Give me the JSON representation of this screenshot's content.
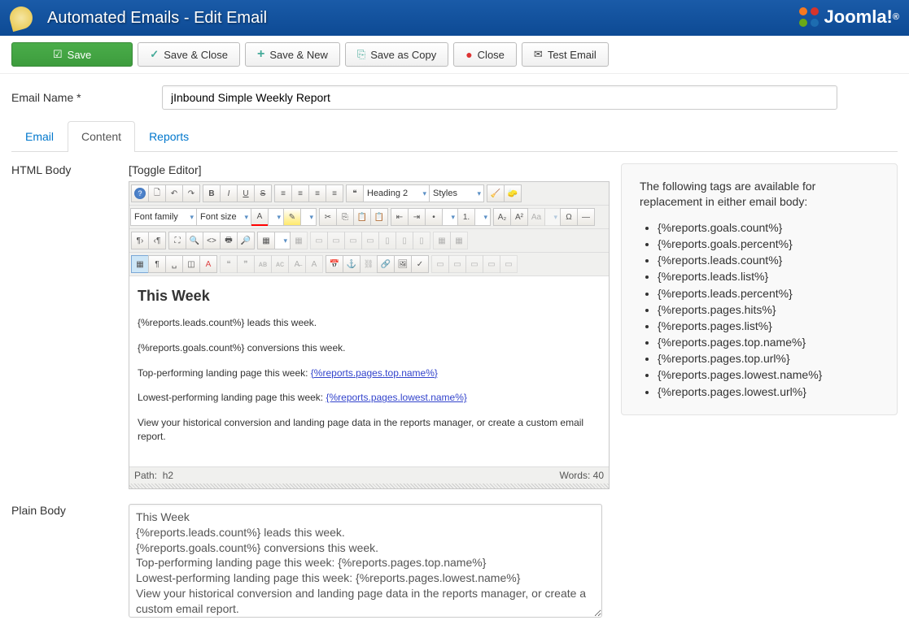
{
  "header": {
    "title": "Automated Emails - Edit Email",
    "logo_text": "Joomla!"
  },
  "toolbar": {
    "save": "Save",
    "save_close": "Save & Close",
    "save_new": "Save & New",
    "save_copy": "Save as Copy",
    "close": "Close",
    "test_email": "Test Email"
  },
  "form": {
    "email_name_label": "Email Name *",
    "email_name_value": "jInbound Simple Weekly Report"
  },
  "tabs": {
    "email": "Email",
    "content": "Content",
    "reports": "Reports",
    "active": "content"
  },
  "editor_area": {
    "html_body_label": "HTML Body",
    "plain_body_label": "Plain Body",
    "toggle_editor": "[Toggle Editor]"
  },
  "editor_toolbar": {
    "font_family": "Font family",
    "font_size": "Font size",
    "heading": "Heading 2",
    "styles": "Styles"
  },
  "editor_content": {
    "heading": "This Week",
    "line1_pre": "{%reports.leads.count%} leads this week.",
    "line2_pre": "{%reports.goals.count%} conversions this week.",
    "line3_pre": "Top-performing landing page this week: ",
    "line3_link": "{%reports.pages.top.name%}",
    "line4_pre": "Lowest-performing landing page this week: ",
    "line4_link": "{%reports.pages.lowest.name%}",
    "line5": "View your historical conversion and landing page data in the reports manager, or create a custom email report."
  },
  "editor_footer": {
    "path_label": "Path:",
    "path_value": "h2",
    "words_label": "Words:",
    "words_value": "40"
  },
  "plain_body_value": "This Week\n{%reports.leads.count%} leads this week.\n{%reports.goals.count%} conversions this week.\nTop-performing landing page this week: {%reports.pages.top.name%}\nLowest-performing landing page this week: {%reports.pages.lowest.name%}\nView your historical conversion and landing page data in the reports manager, or create a custom email report.",
  "sidebar": {
    "intro": "The following tags are available for replacement in either email body:",
    "tags": [
      "{%reports.goals.count%}",
      "{%reports.goals.percent%}",
      "{%reports.leads.count%}",
      "{%reports.leads.list%}",
      "{%reports.leads.percent%}",
      "{%reports.pages.hits%}",
      "{%reports.pages.list%}",
      "{%reports.pages.top.name%}",
      "{%reports.pages.top.url%}",
      "{%reports.pages.lowest.name%}",
      "{%reports.pages.lowest.url%}"
    ]
  }
}
